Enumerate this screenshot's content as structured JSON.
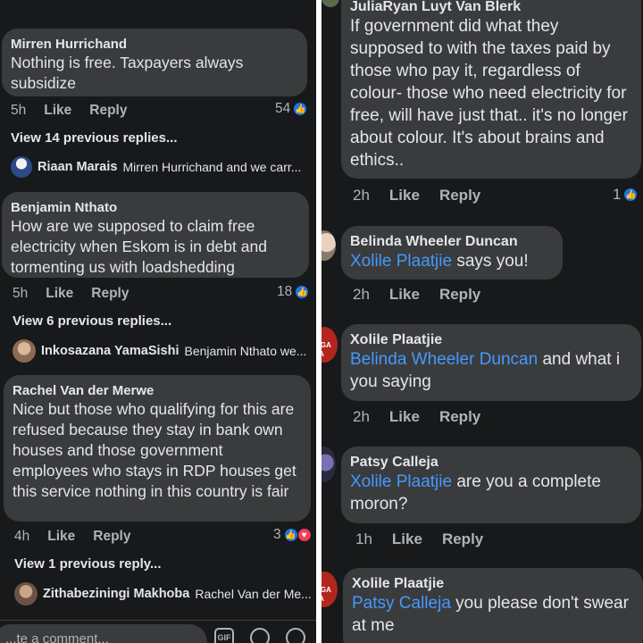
{
  "left": {
    "top_line": "",
    "comments": [
      {
        "author": "Mirren Hurrichand",
        "text": "Nothing is free. Taxpayers always subsidize",
        "time": "5h",
        "like": "Like",
        "reply": "Reply",
        "reactions": "54",
        "view_replies": "View 14 previous replies...",
        "latest_reply_name": "Riaan Marais",
        "latest_reply_text": "Mirren Hurrichand and we carr..."
      },
      {
        "author": "Benjamin Nthato",
        "text": "How are we supposed to claim free electricity when Eskom is in debt and tormenting us with loadshedding",
        "time": "5h",
        "like": "Like",
        "reply": "Reply",
        "reactions": "18",
        "view_replies": "View 6 previous replies...",
        "latest_reply_name": "Inkosazana YamaSishi",
        "latest_reply_text": "Benjamin Nthato we..."
      },
      {
        "author": "Rachel Van der Merwe",
        "text": "Nice but those who qualifying for this are refused because they stay in bank own houses and those government employees who stays in RDP houses get this service  nothing in this country is fair",
        "time": "4h",
        "like": "Like",
        "reply": "Reply",
        "reactions": "3",
        "view_replies": "View 1 previous reply...",
        "latest_reply_name": "Zithabeziningi Makhoba",
        "latest_reply_text": "Rachel Van der Me..."
      }
    ],
    "composer": {
      "placeholder": "...te a comment...",
      "gif_label": "GIF"
    }
  },
  "right": {
    "comments": [
      {
        "author": "JuliaRyan Luyt Van Blerk",
        "mention": "",
        "text": "If government did what they supposed to with the taxes paid by those who pay it, regardless of colour- those who need electricity for free, will have just  that.. it's no longer about colour. It's about brains and ethics..",
        "time": "2h",
        "like": "Like",
        "reply": "Reply",
        "reactions": "1"
      },
      {
        "author": "Belinda Wheeler Duncan",
        "mention": "Xolile Plaatjie",
        "text": " says you!",
        "time": "2h",
        "like": "Like",
        "reply": "Reply",
        "reactions": ""
      },
      {
        "author": "Xolile Plaatjie",
        "mention": "Belinda Wheeler Duncan",
        "text": " and what i you saying",
        "time": "2h",
        "like": "Like",
        "reply": "Reply",
        "reactions": ""
      },
      {
        "author": "Patsy Calleja",
        "mention": "Xolile Plaatjie",
        "text": " are you a complete moron?",
        "time": "1h",
        "like": "Like",
        "reply": "Reply",
        "reactions": ""
      },
      {
        "author": "Xolile Plaatjie",
        "mention": "Patsy Calleja",
        "text": " you please don't swear at me",
        "time": "",
        "like": "",
        "reply": "",
        "reactions": ""
      }
    ],
    "avatar_logo_text": "GA\nWA"
  },
  "colors": {
    "background": "#18191a",
    "bubble": "#3a3b3c",
    "mention": "#4599ff",
    "like_blue": "#1877f2",
    "love_red": "#f33e58",
    "secondary_text": "#b0b3b8"
  },
  "icons": [
    "like-reaction-icon",
    "love-reaction-icon",
    "gif-icon",
    "sticker-icon",
    "emoji-icon"
  ]
}
